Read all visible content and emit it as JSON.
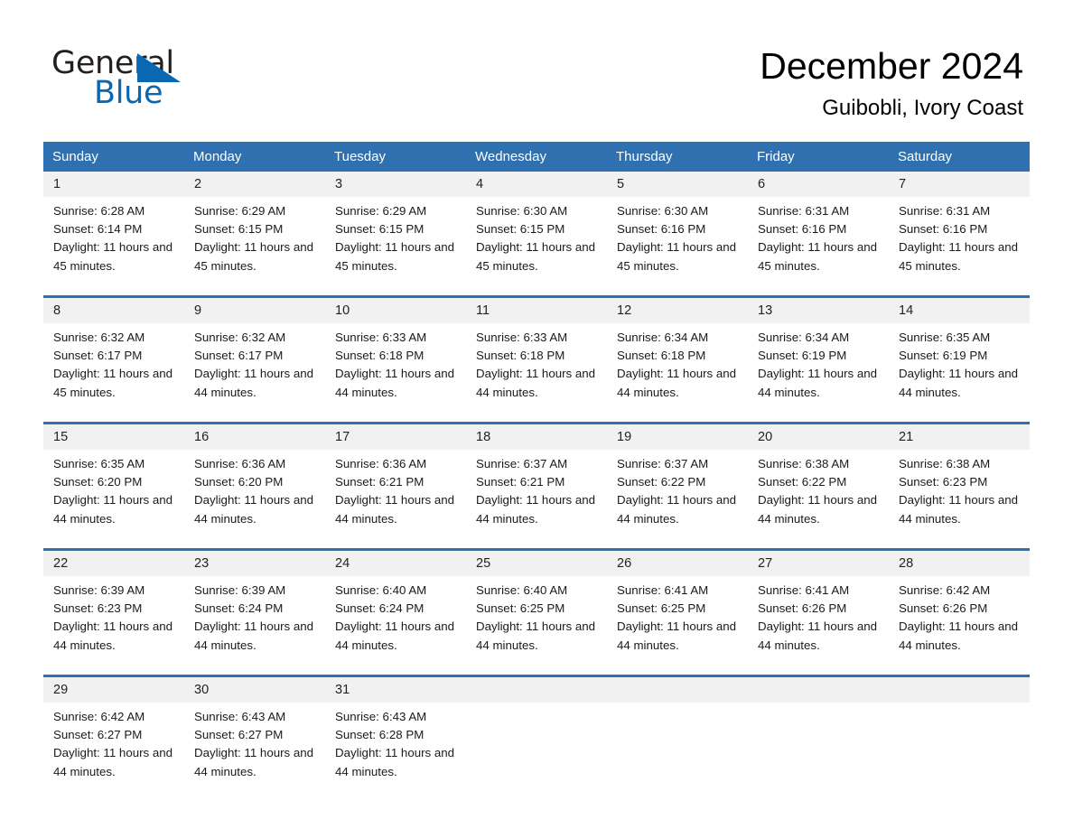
{
  "logo": {
    "word_one": "General",
    "word_two": "Blue",
    "triangle_icon": "triangle-icon",
    "brand_color": "#0a68b2"
  },
  "header": {
    "title": "December 2024",
    "subtitle": "Guibobli, Ivory Coast"
  },
  "colors": {
    "header_blue": "#2e70b0",
    "row_divider_blue": "#2e70b0",
    "daynum_band_gray": "#f1f1f1",
    "text": "#000000"
  },
  "weekdays": [
    "Sunday",
    "Monday",
    "Tuesday",
    "Wednesday",
    "Thursday",
    "Friday",
    "Saturday"
  ],
  "weeks": [
    [
      {
        "day": "1",
        "sunrise": "Sunrise: 6:28 AM",
        "sunset": "Sunset: 6:14 PM",
        "daylight": "Daylight: 11 hours and 45 minutes."
      },
      {
        "day": "2",
        "sunrise": "Sunrise: 6:29 AM",
        "sunset": "Sunset: 6:15 PM",
        "daylight": "Daylight: 11 hours and 45 minutes."
      },
      {
        "day": "3",
        "sunrise": "Sunrise: 6:29 AM",
        "sunset": "Sunset: 6:15 PM",
        "daylight": "Daylight: 11 hours and 45 minutes."
      },
      {
        "day": "4",
        "sunrise": "Sunrise: 6:30 AM",
        "sunset": "Sunset: 6:15 PM",
        "daylight": "Daylight: 11 hours and 45 minutes."
      },
      {
        "day": "5",
        "sunrise": "Sunrise: 6:30 AM",
        "sunset": "Sunset: 6:16 PM",
        "daylight": "Daylight: 11 hours and 45 minutes."
      },
      {
        "day": "6",
        "sunrise": "Sunrise: 6:31 AM",
        "sunset": "Sunset: 6:16 PM",
        "daylight": "Daylight: 11 hours and 45 minutes."
      },
      {
        "day": "7",
        "sunrise": "Sunrise: 6:31 AM",
        "sunset": "Sunset: 6:16 PM",
        "daylight": "Daylight: 11 hours and 45 minutes."
      }
    ],
    [
      {
        "day": "8",
        "sunrise": "Sunrise: 6:32 AM",
        "sunset": "Sunset: 6:17 PM",
        "daylight": "Daylight: 11 hours and 45 minutes."
      },
      {
        "day": "9",
        "sunrise": "Sunrise: 6:32 AM",
        "sunset": "Sunset: 6:17 PM",
        "daylight": "Daylight: 11 hours and 44 minutes."
      },
      {
        "day": "10",
        "sunrise": "Sunrise: 6:33 AM",
        "sunset": "Sunset: 6:18 PM",
        "daylight": "Daylight: 11 hours and 44 minutes."
      },
      {
        "day": "11",
        "sunrise": "Sunrise: 6:33 AM",
        "sunset": "Sunset: 6:18 PM",
        "daylight": "Daylight: 11 hours and 44 minutes."
      },
      {
        "day": "12",
        "sunrise": "Sunrise: 6:34 AM",
        "sunset": "Sunset: 6:18 PM",
        "daylight": "Daylight: 11 hours and 44 minutes."
      },
      {
        "day": "13",
        "sunrise": "Sunrise: 6:34 AM",
        "sunset": "Sunset: 6:19 PM",
        "daylight": "Daylight: 11 hours and 44 minutes."
      },
      {
        "day": "14",
        "sunrise": "Sunrise: 6:35 AM",
        "sunset": "Sunset: 6:19 PM",
        "daylight": "Daylight: 11 hours and 44 minutes."
      }
    ],
    [
      {
        "day": "15",
        "sunrise": "Sunrise: 6:35 AM",
        "sunset": "Sunset: 6:20 PM",
        "daylight": "Daylight: 11 hours and 44 minutes."
      },
      {
        "day": "16",
        "sunrise": "Sunrise: 6:36 AM",
        "sunset": "Sunset: 6:20 PM",
        "daylight": "Daylight: 11 hours and 44 minutes."
      },
      {
        "day": "17",
        "sunrise": "Sunrise: 6:36 AM",
        "sunset": "Sunset: 6:21 PM",
        "daylight": "Daylight: 11 hours and 44 minutes."
      },
      {
        "day": "18",
        "sunrise": "Sunrise: 6:37 AM",
        "sunset": "Sunset: 6:21 PM",
        "daylight": "Daylight: 11 hours and 44 minutes."
      },
      {
        "day": "19",
        "sunrise": "Sunrise: 6:37 AM",
        "sunset": "Sunset: 6:22 PM",
        "daylight": "Daylight: 11 hours and 44 minutes."
      },
      {
        "day": "20",
        "sunrise": "Sunrise: 6:38 AM",
        "sunset": "Sunset: 6:22 PM",
        "daylight": "Daylight: 11 hours and 44 minutes."
      },
      {
        "day": "21",
        "sunrise": "Sunrise: 6:38 AM",
        "sunset": "Sunset: 6:23 PM",
        "daylight": "Daylight: 11 hours and 44 minutes."
      }
    ],
    [
      {
        "day": "22",
        "sunrise": "Sunrise: 6:39 AM",
        "sunset": "Sunset: 6:23 PM",
        "daylight": "Daylight: 11 hours and 44 minutes."
      },
      {
        "day": "23",
        "sunrise": "Sunrise: 6:39 AM",
        "sunset": "Sunset: 6:24 PM",
        "daylight": "Daylight: 11 hours and 44 minutes."
      },
      {
        "day": "24",
        "sunrise": "Sunrise: 6:40 AM",
        "sunset": "Sunset: 6:24 PM",
        "daylight": "Daylight: 11 hours and 44 minutes."
      },
      {
        "day": "25",
        "sunrise": "Sunrise: 6:40 AM",
        "sunset": "Sunset: 6:25 PM",
        "daylight": "Daylight: 11 hours and 44 minutes."
      },
      {
        "day": "26",
        "sunrise": "Sunrise: 6:41 AM",
        "sunset": "Sunset: 6:25 PM",
        "daylight": "Daylight: 11 hours and 44 minutes."
      },
      {
        "day": "27",
        "sunrise": "Sunrise: 6:41 AM",
        "sunset": "Sunset: 6:26 PM",
        "daylight": "Daylight: 11 hours and 44 minutes."
      },
      {
        "day": "28",
        "sunrise": "Sunrise: 6:42 AM",
        "sunset": "Sunset: 6:26 PM",
        "daylight": "Daylight: 11 hours and 44 minutes."
      }
    ],
    [
      {
        "day": "29",
        "sunrise": "Sunrise: 6:42 AM",
        "sunset": "Sunset: 6:27 PM",
        "daylight": "Daylight: 11 hours and 44 minutes."
      },
      {
        "day": "30",
        "sunrise": "Sunrise: 6:43 AM",
        "sunset": "Sunset: 6:27 PM",
        "daylight": "Daylight: 11 hours and 44 minutes."
      },
      {
        "day": "31",
        "sunrise": "Sunrise: 6:43 AM",
        "sunset": "Sunset: 6:28 PM",
        "daylight": "Daylight: 11 hours and 44 minutes."
      },
      {
        "day": "",
        "sunrise": "",
        "sunset": "",
        "daylight": ""
      },
      {
        "day": "",
        "sunrise": "",
        "sunset": "",
        "daylight": ""
      },
      {
        "day": "",
        "sunrise": "",
        "sunset": "",
        "daylight": ""
      },
      {
        "day": "",
        "sunrise": "",
        "sunset": "",
        "daylight": ""
      }
    ]
  ]
}
